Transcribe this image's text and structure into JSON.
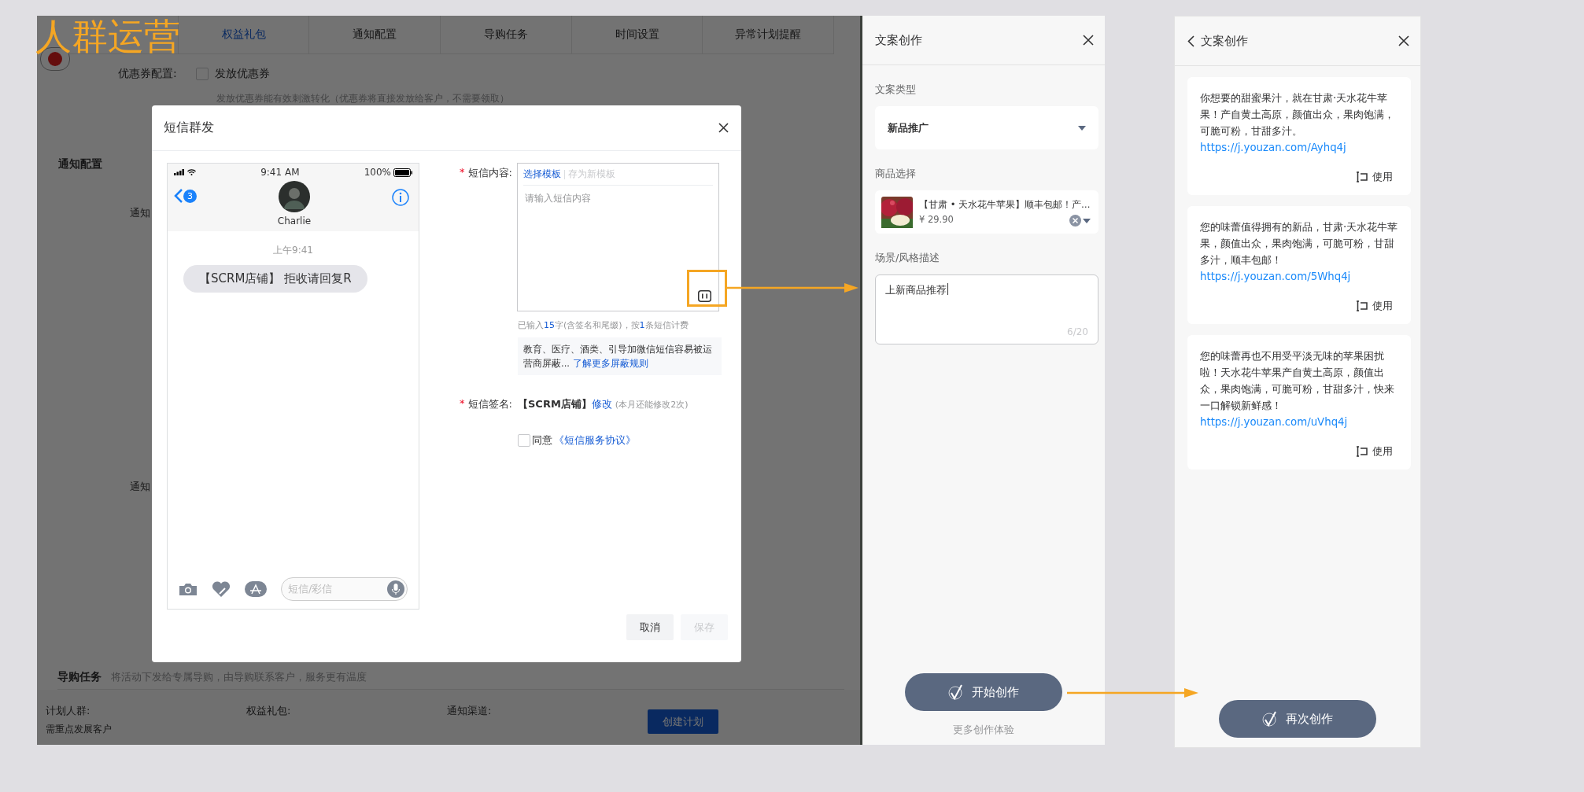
{
  "annotation": {
    "title": "人群运营"
  },
  "background_page": {
    "tabs": [
      {
        "label": "权益礼包",
        "selected": true
      },
      {
        "label": "通知配置",
        "selected": false
      },
      {
        "label": "导购任务",
        "selected": false
      },
      {
        "label": "时间设置",
        "selected": false
      },
      {
        "label": "异常计划提醒",
        "selected": false
      }
    ],
    "coupon": {
      "label": "优惠券配置:",
      "checkbox_label": "发放优惠券",
      "checked": false,
      "hint": "发放优惠券能有效刺激转化（优惠券将直接发放给客户，不需要领取）"
    },
    "notify_section": {
      "title": "通知配置",
      "labels": [
        "通知",
        "通知"
      ]
    },
    "guide_task": {
      "title": "导购任务",
      "description": "将活动下发给专属导购，由导购联系客户，服务更有温度"
    },
    "footer": {
      "fields": [
        {
          "label": "计划人群:",
          "value": "需重点发展客户"
        },
        {
          "label": "权益礼包:"
        },
        {
          "label": "通知渠道:"
        }
      ],
      "button": "创建计划"
    }
  },
  "sms_dialog": {
    "title": "短信群发",
    "phone": {
      "time": "9:41 AM",
      "battery": "100%",
      "badge": "3",
      "contact": "Charlie",
      "timestamp": "上午9:41",
      "message": "【SCRM店铺】 拒收请回复R",
      "input_placeholder": "短信/彩信"
    },
    "content": {
      "label": "短信内容:",
      "required_mark": "*",
      "template_link": "选择模板",
      "save_template": {
        "label": "存为新模板",
        "disabled": true
      },
      "placeholder": "请输入短信内容"
    },
    "counter": [
      {
        "kind": "text",
        "text": "已输入"
      },
      {
        "kind": "number",
        "text": "15"
      },
      {
        "kind": "text",
        "text": "字(含签名和尾缀)，按"
      },
      {
        "kind": "number",
        "text": "1"
      },
      {
        "kind": "text",
        "text": "条短信计费"
      }
    ],
    "notice": {
      "text": "教育、医疗、酒类、引导加微信短信容易被运营商屏蔽... ",
      "link": "了解更多屏蔽规则"
    },
    "signature": {
      "label": "短信签名:",
      "required_mark": "*",
      "value": "【SCRM店铺】",
      "edit_link": "修改",
      "note": "(本月还能修改2次)"
    },
    "agreement": {
      "checked": false,
      "text": "同意",
      "link": "《短信服务协议》"
    },
    "buttons": [
      {
        "label": "取消",
        "disabled": false
      },
      {
        "label": "保存",
        "disabled": true
      }
    ]
  },
  "copy_panel": {
    "title": "文案创作",
    "type_field": {
      "label": "文案类型",
      "value": "新品推广"
    },
    "product_field": {
      "label": "商品选择",
      "name": "【甘肃 • 天水花牛苹果】顺丰包邮！产…",
      "price": "¥ 29.90"
    },
    "scene_field": {
      "label": "场景/风格描述",
      "value": "上新商品推荐",
      "count": "6/20"
    },
    "button": "开始创作",
    "more_link": "更多创作体验"
  },
  "results_panel": {
    "title": "文案创作",
    "results": [
      {
        "text": "你想要的甜蜜果汁，就在甘肃·天水花牛苹果！产自黄土高原，颜值出众，果肉饱满，可脆可粉，甘甜多汁。",
        "link": "https://j.youzan.com/Ayhq4j",
        "use": "使用"
      },
      {
        "text": "您的味蕾值得拥有的新品，甘肃·天水花牛苹果，颜值出众，果肉饱满，可脆可粉，甘甜多汁，顺丰包邮！",
        "link": "https://j.youzan.com/5Whq4j",
        "use": "使用"
      },
      {
        "text": "您的味蕾再也不用受平淡无味的苹果困扰啦！天水花牛苹果产自黄土高原，颜值出众，果肉饱满，可脆可粉，甘甜多汁，快来一口解锁新鲜感！",
        "link": "https://j.youzan.com/uVhq4j",
        "use": "使用"
      }
    ],
    "button": "再次创作"
  }
}
